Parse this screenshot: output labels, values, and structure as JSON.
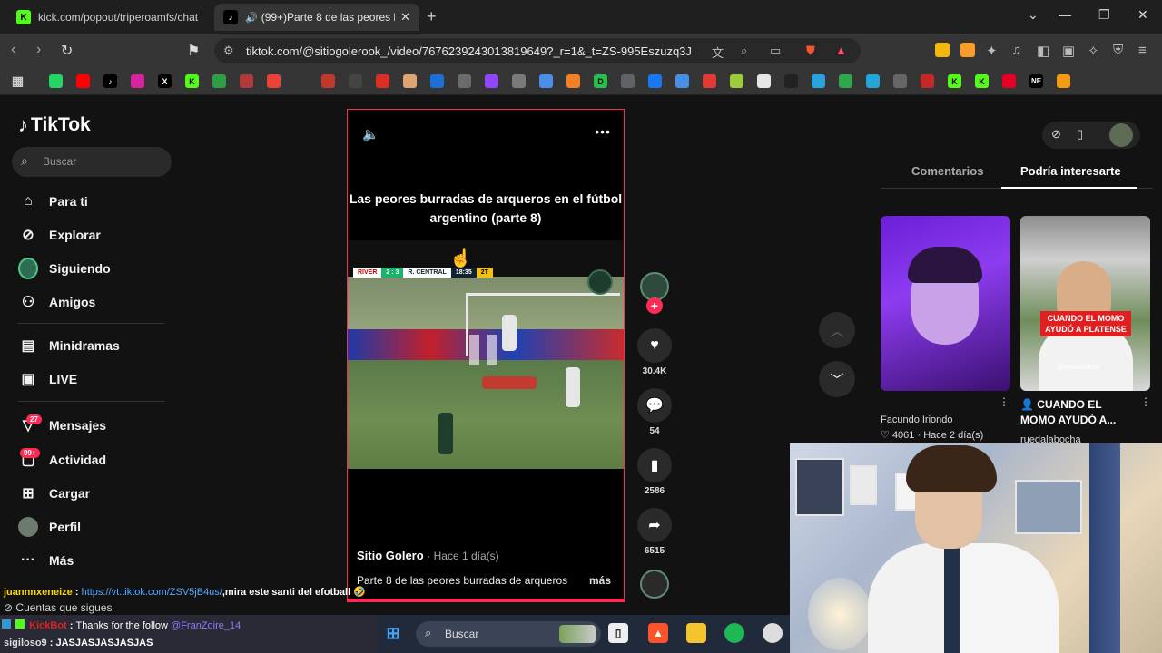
{
  "browser": {
    "tabs": [
      {
        "title": "kick.com/popout/triperoamfs/chat",
        "favicon": "K"
      },
      {
        "title": "(99+)Parte 8 de las peores bu",
        "favicon": "♪"
      }
    ],
    "url": "tiktok.com/@sitiogolerook_/video/7676239243013819649?_r=1&_t=ZS-995Eszuzq3J"
  },
  "sidebar": {
    "logo": "TikTok",
    "search_placeholder": "Buscar",
    "items": [
      {
        "label": "Para ti",
        "icon": "home-icon"
      },
      {
        "label": "Explorar",
        "icon": "compass-icon"
      },
      {
        "label": "Siguiendo",
        "icon": "following-avatar-icon"
      },
      {
        "label": "Amigos",
        "icon": "friends-icon"
      },
      {
        "label": "Minidramas",
        "icon": "film-icon"
      },
      {
        "label": "LIVE",
        "icon": "live-tv-icon"
      },
      {
        "label": "Mensajes",
        "icon": "message-icon",
        "badge": "27"
      },
      {
        "label": "Actividad",
        "icon": "activity-icon",
        "badge": "99+"
      },
      {
        "label": "Cargar",
        "icon": "upload-icon"
      },
      {
        "label": "Perfil",
        "icon": "profile-avatar-icon"
      },
      {
        "label": "Más",
        "icon": "more-icon"
      }
    ],
    "following_label": "Cuentas que sigues"
  },
  "video": {
    "title": "Las peores burradas de arqueros en el fútbol argentino (parte 8)",
    "scorebug": {
      "home": "RIVER",
      "score": "2 : 3",
      "away": "R. CENTRAL",
      "time": "18:35",
      "half": "2T"
    },
    "author": "Sitio Golero",
    "posted": "· Hace 1 día(s)",
    "caption": "Parte 8 de las peores burradas de arqueros",
    "more_label": "más",
    "progress": 1.0,
    "accent_color": "#fe2c55"
  },
  "actions": {
    "likes": "30.4K",
    "comments": "54",
    "saves": "2586",
    "shares": "6515"
  },
  "right_panel": {
    "tabs": [
      "Comentarios",
      "Podría interesarte"
    ],
    "selected_tab": "Podría interesarte",
    "cards": [
      {
        "meta_top": "Facundo Iriondo",
        "likes": "4061",
        "posted": "· Hace 2 día(s)"
      },
      {
        "title": "CUANDO EL MOMO AYUDÓ A...",
        "author": "ruedalabocha",
        "overlay": "CUANDO EL MOMO AYUDÓ A PLATENSE",
        "watermark": "@ruedalaboc"
      }
    ]
  },
  "chat": [
    {
      "user": "juannnxeneize",
      "sep": " : ",
      "link": "https://vt.tiktok.com/ZSV5jB4us/",
      "text": ",mira este santi del efotball 🤣"
    },
    {
      "user": "KickBot",
      "sep": " : ",
      "text": "Thanks for the follow",
      "mention": "@FranZoire_14"
    },
    {
      "user": "sigiloso9",
      "sep": " : ",
      "text": "JASJASJASJASJAS"
    }
  ],
  "taskbar": {
    "search_placeholder": "Buscar"
  }
}
